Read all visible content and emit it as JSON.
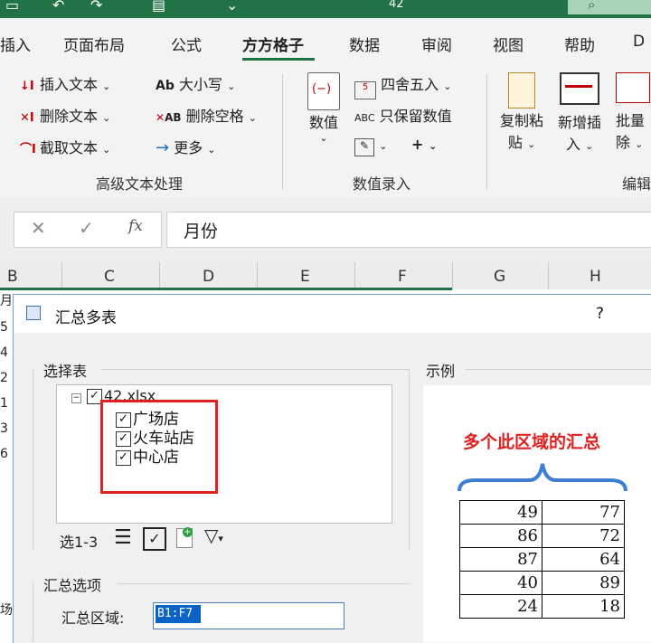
{
  "app": {
    "title_fragment": "42",
    "quick_access": [
      "save-icon",
      "undo-icon",
      "redo-icon",
      "print-preview-icon",
      "customize-icon"
    ]
  },
  "tabs": [
    "插入",
    "页面布局",
    "公式",
    "方方格子",
    "数据",
    "审阅",
    "视图",
    "帮助",
    "D"
  ],
  "active_tab": "方方格子",
  "ribbon": {
    "text_group": {
      "label": "高级文本处理",
      "buttons": [
        "插入文本",
        "删除文本",
        "截取文本",
        "大小写",
        "删除空格",
        "更多"
      ],
      "case_icon_text": "Ab",
      "space_icon_text": "AB"
    },
    "number_group": {
      "label": "数值录入",
      "big_button": "数值",
      "buttons": [
        "四舍五入",
        "只保留数值"
      ],
      "abc_icon_text": "ABC",
      "plus_text": "+"
    },
    "right_group": {
      "buttons": [
        "复制粘",
        "贴",
        "新增插",
        "入",
        "批量",
        "除"
      ],
      "label": "编辑"
    }
  },
  "formula_bar": {
    "cancel": "✕",
    "enter": "✓",
    "fx": "fx",
    "value": "月份"
  },
  "sheet": {
    "columns": [
      "B",
      "C",
      "D",
      "E",
      "F",
      "G",
      "H"
    ],
    "row_fragments": [
      "月",
      "5",
      "4",
      "2",
      "1",
      "3",
      "6",
      "场"
    ]
  },
  "dialog": {
    "title": "汇总多表",
    "help": "?",
    "select_section": "选择表",
    "file_name": "42.xlsx",
    "tree_items": [
      "广场店",
      "火车站店",
      "中心店"
    ],
    "select_range": "选1-3",
    "example_section": "示例",
    "example_caption": "多个此区域的汇总",
    "example_table": [
      [
        49,
        77
      ],
      [
        86,
        72
      ],
      [
        87,
        64
      ],
      [
        40,
        89
      ],
      [
        24,
        18
      ]
    ],
    "options_section": "汇总选项",
    "range_label": "汇总区域:",
    "range_value": "B1:F7"
  },
  "colors": {
    "accent": "#217346",
    "highlight": "#e02020",
    "selection": "#0b63c6"
  }
}
